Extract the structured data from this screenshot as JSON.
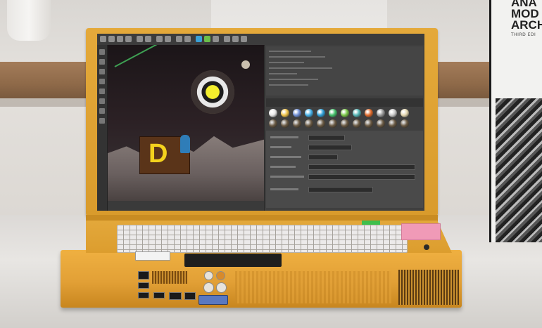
{
  "scene": {
    "description_kind": "photo",
    "laptop_color": "#e4a93a",
    "accent_colors": {
      "keyboard": "#eceaea",
      "sticker": "#f09ab7",
      "led": "#3fbf4c",
      "vga_port": "#5a78c0"
    }
  },
  "book": {
    "title_lines": "ANA\nMOD\nARCH",
    "subtitle": "THIRD EDI"
  },
  "screen": {
    "app": "3d-modeling-software",
    "viewport_logo_text": "D",
    "material_swatches": [
      "#e6e6e6",
      "#f0c44a",
      "#6f8fd6",
      "#45b0e8",
      "#2fa0d8",
      "#44c06a",
      "#7cc84a",
      "#55b5b5",
      "#e06a2a",
      "#9a9a9a",
      "#c8c8c8",
      "#e4d7b0"
    ]
  }
}
